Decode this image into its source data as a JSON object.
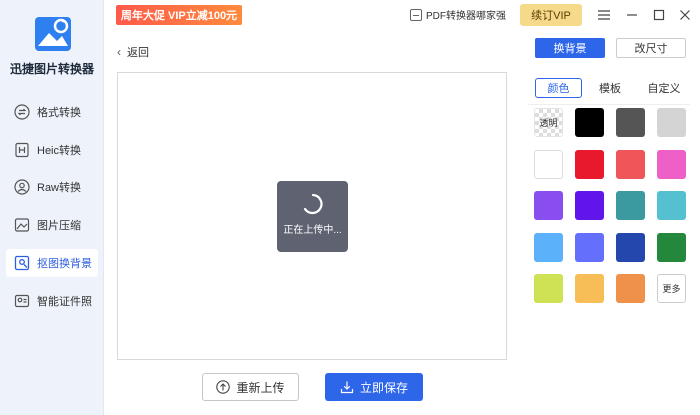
{
  "app": {
    "name": "迅捷图片转换器"
  },
  "sidebar": {
    "items": [
      {
        "label": "格式转换",
        "icon": "swap-icon"
      },
      {
        "label": "Heic转换",
        "icon": "heic-icon"
      },
      {
        "label": "Raw转换",
        "icon": "raw-icon"
      },
      {
        "label": "图片压缩",
        "icon": "compress-icon"
      },
      {
        "label": "抠图换背景",
        "icon": "cutout-icon",
        "active": true
      },
      {
        "label": "智能证件照",
        "icon": "id-photo-icon"
      }
    ]
  },
  "topbar": {
    "promo": "周年大促 VIP立减100元",
    "pdf_link": "PDF转换器哪家强",
    "renew": "续订VIP"
  },
  "main": {
    "back": "返回",
    "loading": "正在上传中...",
    "reupload": "重新上传",
    "save": "立即保存"
  },
  "panel": {
    "tabs": [
      "换背景",
      "改尺寸"
    ],
    "subtabs": [
      "颜色",
      "模板",
      "自定义"
    ],
    "transparent_label": "透明",
    "more_label": "更多",
    "colors": [
      "transparent",
      "#000000",
      "#555555",
      "#d4d4d4",
      "#ffffff",
      "#e8192c",
      "#ef5659",
      "#ef5fc8",
      "#8a4df0",
      "#6115ea",
      "#3b9aa0",
      "#55c0cf",
      "#5bb2fa",
      "#6470fb",
      "#2347ad",
      "#23883c",
      "#cfe253",
      "#f7be57",
      "#f0914b",
      "more"
    ]
  }
}
